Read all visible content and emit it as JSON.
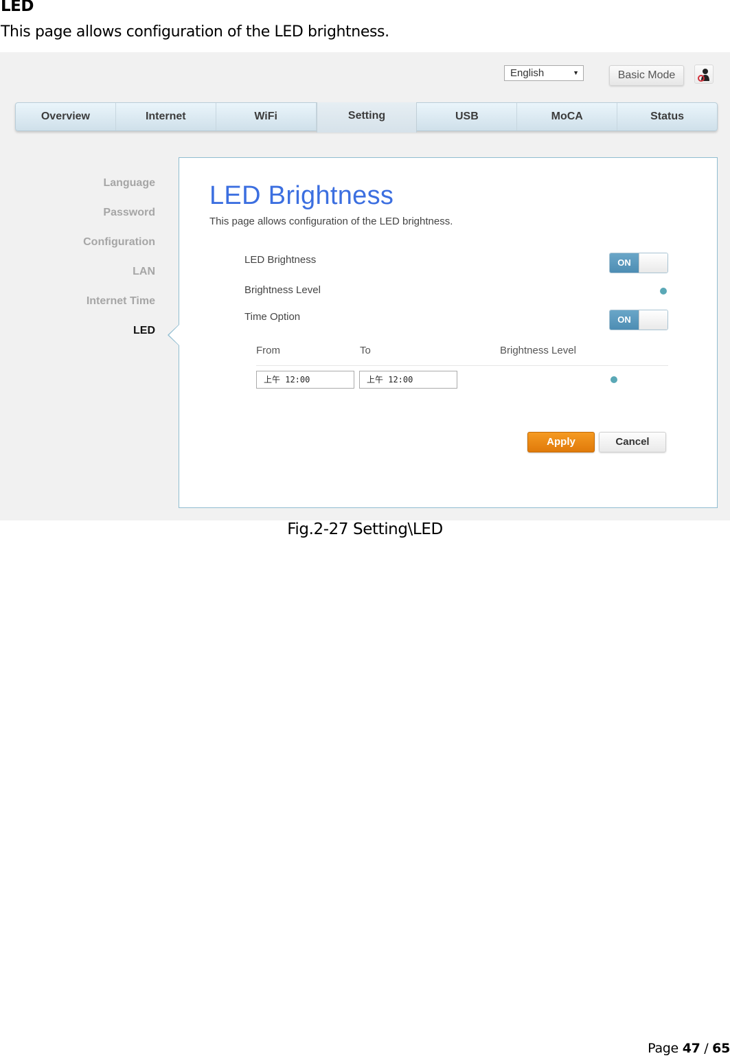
{
  "document": {
    "heading": "LED",
    "intro": "This page allows configuration of the LED brightness.",
    "caption": "Fig.2-27 Setting\\LED",
    "footer": {
      "prefix": "Page",
      "current": "47",
      "separator": "/",
      "total": "65"
    }
  },
  "header": {
    "language": "English",
    "language_arrow": "▼",
    "basic_mode_label": "Basic Mode",
    "user_icon": "user-icon"
  },
  "nav": {
    "tabs": [
      {
        "label": "Overview",
        "active": false
      },
      {
        "label": "Internet",
        "active": false
      },
      {
        "label": "WiFi",
        "active": false
      },
      {
        "label": "Setting",
        "active": true
      },
      {
        "label": "USB",
        "active": false
      },
      {
        "label": "MoCA",
        "active": false
      },
      {
        "label": "Status",
        "active": false
      }
    ]
  },
  "sidebar": {
    "items": [
      {
        "label": "Language",
        "active": false
      },
      {
        "label": "Password",
        "active": false
      },
      {
        "label": "Configuration",
        "active": false
      },
      {
        "label": "LAN",
        "active": false
      },
      {
        "label": "Internet Time",
        "active": false
      },
      {
        "label": "LED",
        "active": true
      }
    ]
  },
  "panel": {
    "title": "LED Brightness",
    "description": "This page allows configuration of the LED brightness.",
    "led_brightness": {
      "label": "LED Brightness",
      "toggle": "ON"
    },
    "brightness_level": {
      "label": "Brightness Level"
    },
    "time_option": {
      "label": "Time Option",
      "toggle": "ON"
    },
    "schedule": {
      "columns": [
        "From",
        "To",
        "Brightness Level"
      ],
      "rows": [
        {
          "from": "上午 12:00",
          "to": "上午 12:00"
        }
      ]
    },
    "apply_label": "Apply",
    "cancel_label": "Cancel"
  },
  "colors": {
    "title_blue": "#3c6fe0",
    "toggle_on": "#4d8db3",
    "dot": "#5aa8b6",
    "apply_orange": "#e98a14"
  }
}
